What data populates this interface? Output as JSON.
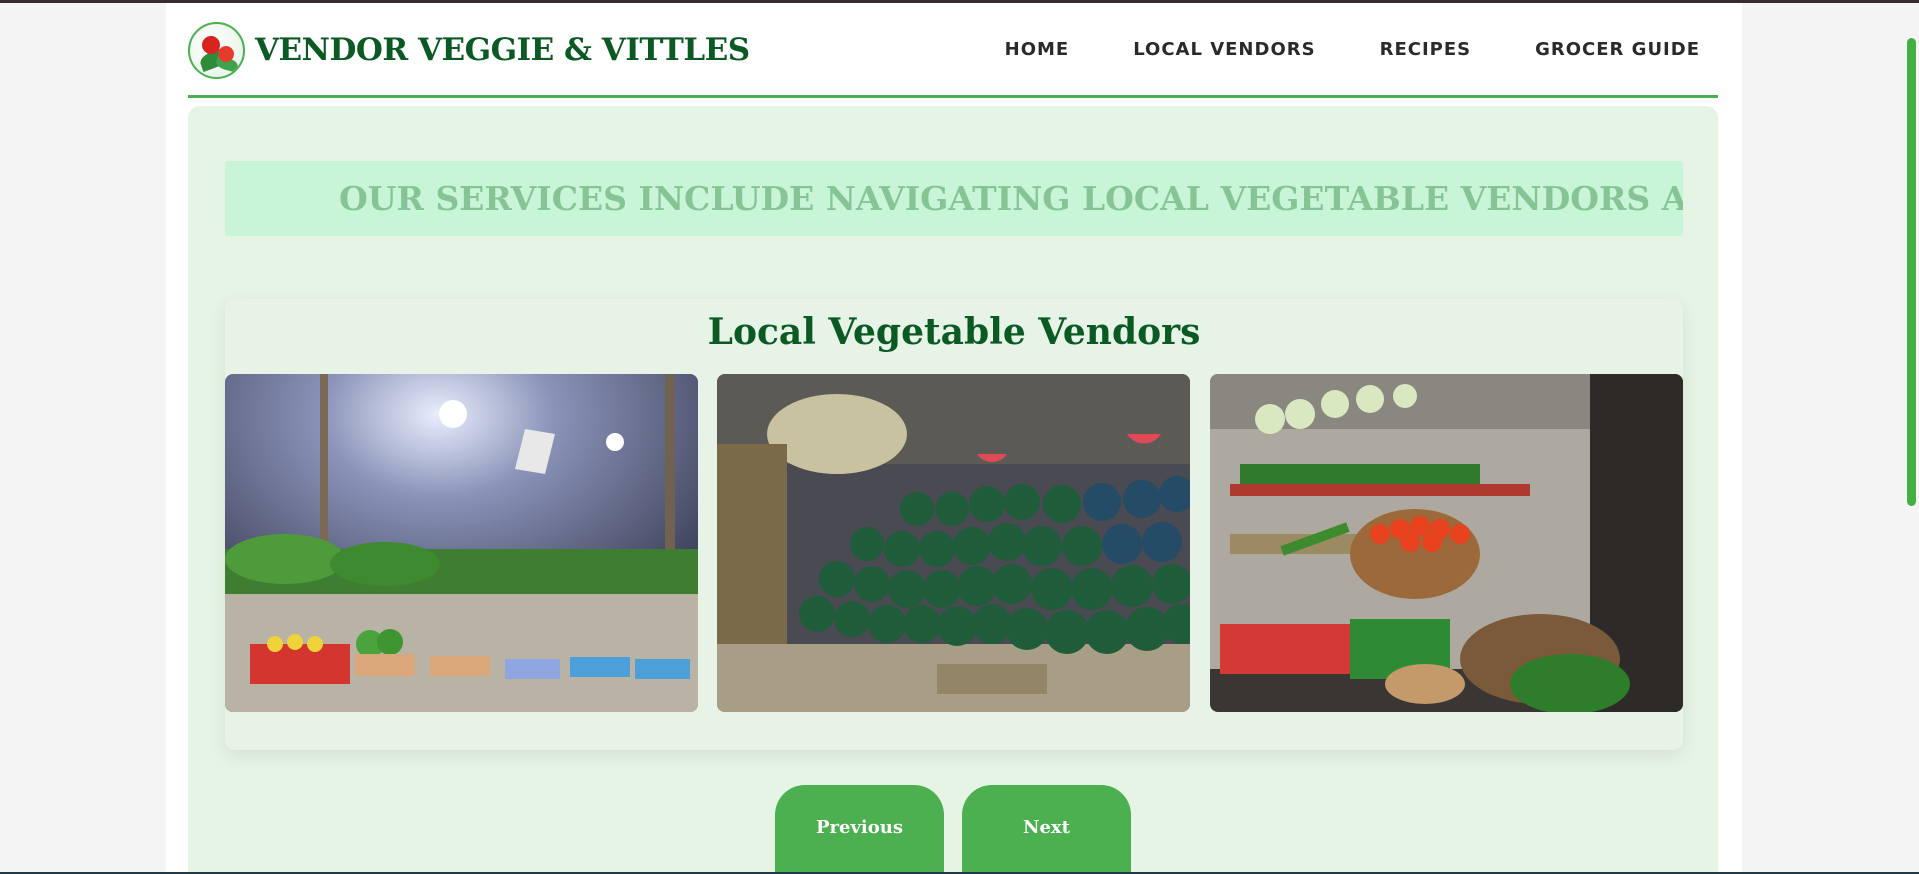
{
  "brand": {
    "title": "VENDOR VEGGIE & VITTLES",
    "logo_icon": "vegetable-logo-icon"
  },
  "nav": {
    "items": [
      {
        "label": "HOME"
      },
      {
        "label": "LOCAL VENDORS"
      },
      {
        "label": "RECIPES"
      },
      {
        "label": "GROCER GUIDE"
      }
    ]
  },
  "marquee": {
    "text": "OUR SERVICES INCLUDE NAVIGATING LOCAL VEGETABLE VENDORS AND EXP"
  },
  "vendors": {
    "title": "Local Vegetable Vendors",
    "photos": [
      {
        "subject": "leafy greens and peppers stall under lights"
      },
      {
        "subject": "watermelon pile stall"
      },
      {
        "subject": "tomatoes and vegetables in baskets stall"
      }
    ]
  },
  "pager": {
    "previous_label": "Previous",
    "next_label": "Next"
  },
  "colors": {
    "brand_green": "#0b5a23",
    "accent_green": "#4caf50",
    "content_bg": "#e6f4e6",
    "marquee_bg": "#c8f5d8"
  }
}
